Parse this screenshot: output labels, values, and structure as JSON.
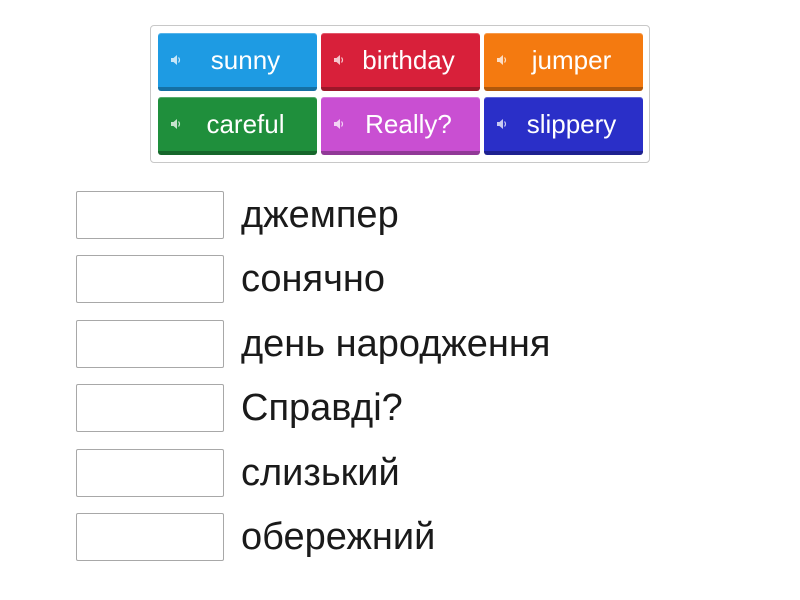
{
  "word_bank": {
    "tiles": [
      {
        "label": "sunny",
        "color": "#1e9be3",
        "icon": "speaker-icon"
      },
      {
        "label": "birthday",
        "color": "#d8203a",
        "icon": "speaker-icon"
      },
      {
        "label": "jumper",
        "color": "#f47a10",
        "icon": "speaker-icon"
      },
      {
        "label": "careful",
        "color": "#1f8f3c",
        "icon": "speaker-icon"
      },
      {
        "label": "Really?",
        "color": "#c94fd2",
        "icon": "speaker-icon"
      },
      {
        "label": "slippery",
        "color": "#2a2fc8",
        "icon": "speaker-icon"
      }
    ]
  },
  "targets": {
    "items": [
      {
        "definition": "джемпер",
        "answer": ""
      },
      {
        "definition": "сонячно",
        "answer": ""
      },
      {
        "definition": "день народження",
        "answer": ""
      },
      {
        "definition": "Справді?",
        "answer": ""
      },
      {
        "definition": "слизький",
        "answer": ""
      },
      {
        "definition": "обережний",
        "answer": ""
      }
    ]
  }
}
